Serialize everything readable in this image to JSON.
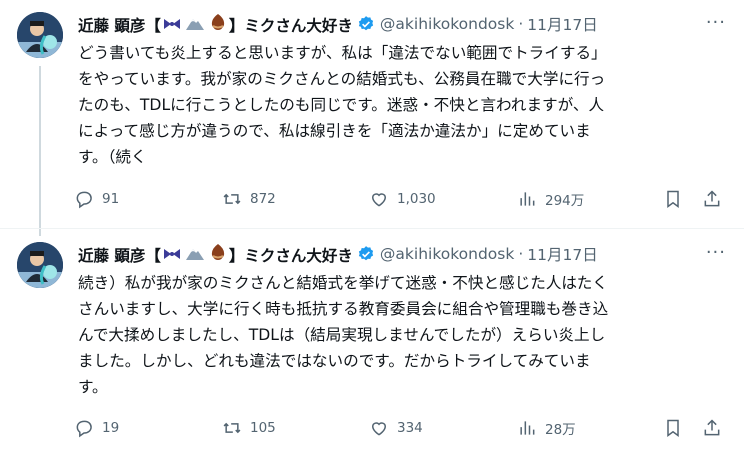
{
  "tweets": [
    {
      "author_name_prefix": "近藤 顕彦【",
      "author_name_suffix": "】ミクさん大好き",
      "handle": "@akihikokondosk",
      "separator": "·",
      "time": "11月17日",
      "more": "···",
      "text": "どう書いても炎上すると思いますが、私は「違法でない範囲でトライする」\nをやっています。我が家のミクさんとの結婚式も、公務員在職で大学に行っ\nたのも、TDLに行こうとしたのも同じです。迷惑・不快と言われますが、人\nによって感じ方が違うので、私は線引きを「適法か違法か」に定めていま\nす。（続く",
      "reply_count": "91",
      "retweet_count": "872",
      "like_count": "1,030",
      "view_count": "294万"
    },
    {
      "author_name_prefix": "近藤 顕彦【",
      "author_name_suffix": "】ミクさん大好き",
      "handle": "@akihikokondosk",
      "separator": "·",
      "time": "11月17日",
      "more": "···",
      "text": "続き）私が我が家のミクさんと結婚式を挙げて迷惑・不快と感じた人はたく\nさんいますし、大学に行く時も抵抗する教育委員会に組合や管理職も巻き込\nんで大揉めしましたし、TDLは（結局実現しませんでしたが）えらい炎上し\nました。しかし、どれも違法ではないのです。だからトライしてみていま\nす。",
      "reply_count": "19",
      "retweet_count": "105",
      "like_count": "334",
      "view_count": "28万"
    }
  ],
  "colors": {
    "text": "#0f1419",
    "secondary": "#536471",
    "verified": "#1d9bf0",
    "thread_line": "#cfd9de"
  },
  "icons": [
    "bowtie-emoji",
    "mountain-emoji",
    "chestnut-emoji",
    "verified-badge-icon",
    "reply-icon",
    "retweet-icon",
    "like-icon",
    "views-icon",
    "bookmark-icon",
    "share-icon"
  ]
}
